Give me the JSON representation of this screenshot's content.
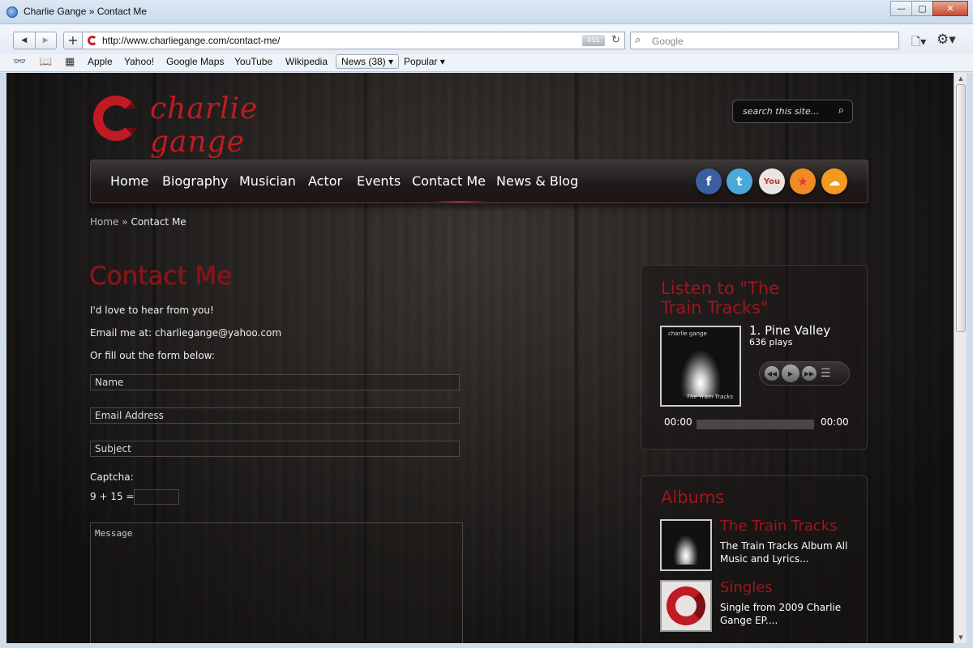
{
  "window": {
    "title": "Charlie Gange » Contact Me",
    "min": "—",
    "max": "▢",
    "close": "✕"
  },
  "toolbar": {
    "back": "◀",
    "forward": "▶",
    "add": "+",
    "url": "http://www.charliegange.com/contact-me/",
    "rss": "RSS",
    "reload": "↻",
    "search_placeholder": "Google",
    "page_menu": "🗋▾",
    "settings_menu": "⚙▾"
  },
  "bookmarks": {
    "items": [
      "Apple",
      "Yahoo!",
      "Google Maps",
      "YouTube",
      "Wikipedia"
    ],
    "news": "News (38) ▾",
    "popular": "Popular ▾"
  },
  "site": {
    "logo_text": "charlie gange",
    "search_placeholder": "search this site...",
    "menu": [
      "Home",
      "Biography",
      "Musician",
      "Actor",
      "Events",
      "Contact Me",
      "News & Blog"
    ],
    "social": [
      {
        "name": "facebook",
        "glyph": "f",
        "color": "#3b5fa0"
      },
      {
        "name": "twitter",
        "glyph": "t",
        "color": "#4aa9d8"
      },
      {
        "name": "youtube",
        "glyph": "You",
        "color": "#e9e5e3"
      },
      {
        "name": "reverbnation",
        "glyph": "★",
        "color": "#f08a24"
      },
      {
        "name": "soundcloud",
        "glyph": "☁",
        "color": "#f39a1e"
      }
    ]
  },
  "breadcrumb": {
    "home": "Home",
    "sep": "»",
    "current": "Contact Me"
  },
  "contact": {
    "title": "Contact Me",
    "intro": "I'd love to hear from you!",
    "email_line": "Email me at: charliegange@yahoo.com",
    "form_line": "Or fill out the form below:",
    "name_placeholder": "Name",
    "email_placeholder": "Email Address",
    "subject_placeholder": "Subject",
    "captcha_label": "Captcha:",
    "captcha_question": "9 + 15 =",
    "message_placeholder": "Message"
  },
  "player": {
    "heading": "Listen to \"The Train Tracks\"",
    "track": "1. Pine Valley",
    "plays": "636 plays",
    "time_current": "00:00",
    "time_total": "00:00",
    "cover_top": "charlie gange",
    "cover_bottom": "The Train Tracks"
  },
  "albums": {
    "heading": "Albums",
    "items": [
      {
        "title": "The Train Tracks",
        "desc": "The Train Tracks Album All Music and Lyrics..."
      },
      {
        "title": "Singles",
        "desc": "Single from 2009 Charlie Gange EP...."
      }
    ]
  }
}
